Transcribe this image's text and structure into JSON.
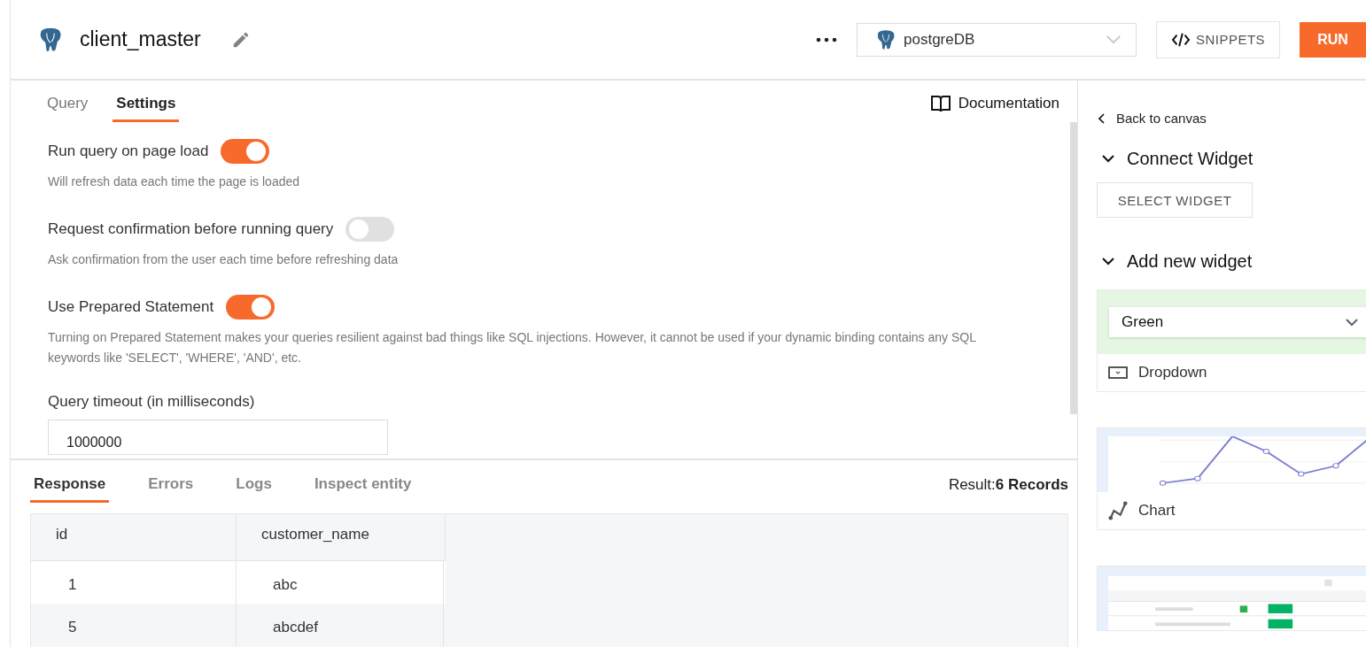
{
  "header": {
    "title": "client_master",
    "datasource": "postgreDB",
    "snippets": "SNIPPETS",
    "run": "RUN"
  },
  "tabs": [
    {
      "label": "Query",
      "selected": false
    },
    {
      "label": "Settings",
      "selected": true
    }
  ],
  "documentation": "Documentation",
  "settings": [
    {
      "label": "Run query on page load",
      "on": true,
      "hint": "Will refresh data each time the page is loaded"
    },
    {
      "label": "Request confirmation before running query",
      "on": false,
      "hint": "Ask confirmation from the user each time before refreshing data"
    },
    {
      "label": "Use Prepared Statement",
      "on": true,
      "hint": "Turning on Prepared Statement makes your queries resilient against bad things like SQL injections. However, it cannot be used if your dynamic binding contains any SQL keywords like 'SELECT', 'WHERE', 'AND', etc."
    }
  ],
  "timeout": {
    "label": "Query timeout (in milliseconds)",
    "value": "1000000"
  },
  "response": {
    "tabs": [
      {
        "label": "Response",
        "selected": true
      },
      {
        "label": "Errors",
        "selected": false
      },
      {
        "label": "Logs",
        "selected": false
      },
      {
        "label": "Inspect entity",
        "selected": false
      }
    ],
    "result": "Result:**6 Records**",
    "columns": [
      "id",
      "customer_name"
    ],
    "rows": [
      [
        "1",
        "abc"
      ],
      [
        "5",
        "abcdef"
      ]
    ]
  },
  "sidebar": {
    "back": "Back to canvas",
    "connect_title": "Connect Widget",
    "select_button": "SELECT WIDGET",
    "add_title": "Add new widget",
    "widgets": [
      {
        "kind": "dropdown",
        "preview": "Green",
        "label": "Dropdown"
      },
      {
        "kind": "chart",
        "label": "Chart"
      },
      {
        "kind": "table"
      }
    ]
  }
}
